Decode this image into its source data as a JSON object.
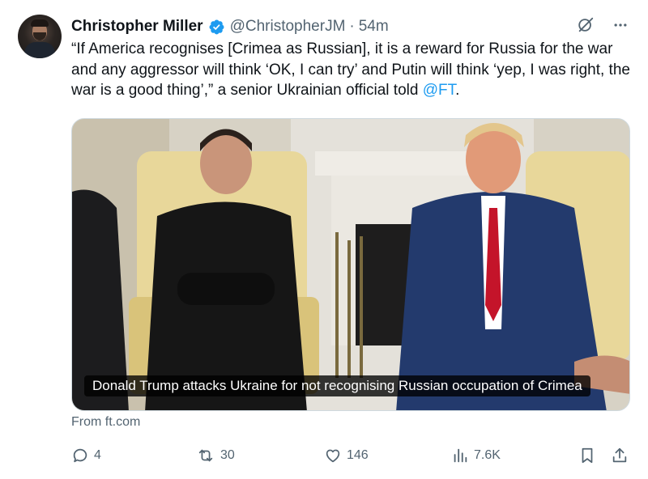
{
  "author": {
    "name": "Christopher Miller",
    "handle": "@ChristopherJM",
    "separator": "·",
    "time": "54m"
  },
  "tweet": {
    "text": "“If America recognises [Crimea as Russian], it is a reward for Russia for the war and any aggressor will think ‘OK, I can try’ and Putin will think ‘yep, I was right, the war is a good thing’,” a senior Ukrainian official told ",
    "mention": "@FT",
    "end": "."
  },
  "media": {
    "caption": "Donald Trump attacks Ukraine for not recognising Russian occupation of Crimea"
  },
  "source": "From ft.com",
  "actions": {
    "replies": "4",
    "reposts": "30",
    "likes": "146",
    "views": "7.6K"
  },
  "icons": [
    "verified-badge-icon",
    "grok-icon",
    "more-icon",
    "reply-icon",
    "repost-icon",
    "like-icon",
    "views-icon",
    "bookmark-icon",
    "share-icon"
  ],
  "colors": {
    "accent": "#1d9bf0",
    "text": "#0f1419",
    "muted": "#536471"
  }
}
